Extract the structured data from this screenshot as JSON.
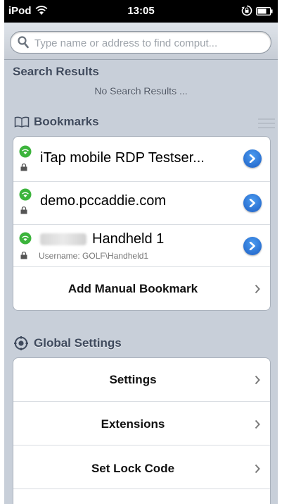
{
  "status_bar": {
    "carrier": "iPod",
    "time": "13:05"
  },
  "search": {
    "placeholder": "Type name or address to find comput..."
  },
  "search_results": {
    "header": "Search Results",
    "empty_text": "No Search Results ..."
  },
  "bookmarks": {
    "header": "Bookmarks",
    "items": [
      {
        "title": "iTap mobile RDP Testser..."
      },
      {
        "title": "demo.pccaddie.com"
      },
      {
        "title": "Handheld 1",
        "subtitle": "Username: GOLF\\Handheld1"
      }
    ],
    "add_label": "Add Manual Bookmark"
  },
  "global_settings": {
    "header": "Global Settings",
    "items": [
      {
        "label": "Settings"
      },
      {
        "label": "Extensions"
      },
      {
        "label": "Set Lock Code"
      }
    ]
  },
  "colors": {
    "background": "#c8cfd9",
    "section_text": "#3f4a5d",
    "accent_blue": "#1d5fc4",
    "wifi_green": "#3cb43c"
  },
  "icons": [
    "wifi-icon",
    "rotation-lock-icon",
    "battery-icon",
    "search-icon",
    "book-icon",
    "gear-icon",
    "lock-icon",
    "disclosure-icon",
    "chevron-right-icon"
  ]
}
